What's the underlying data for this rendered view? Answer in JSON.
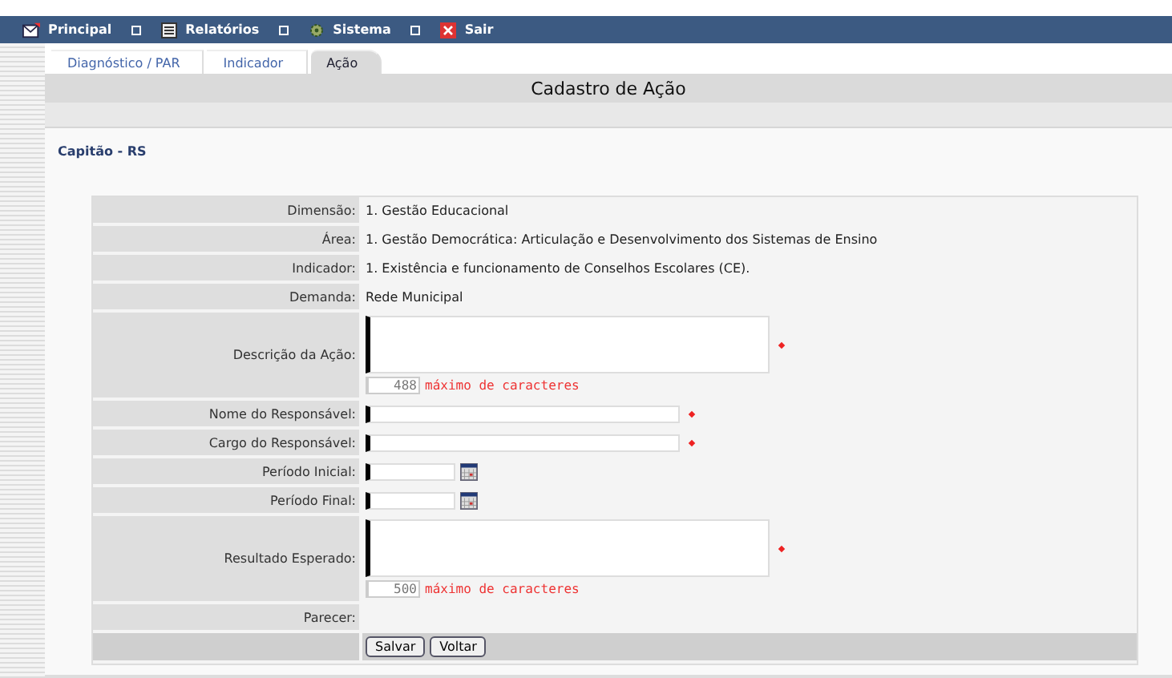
{
  "menu": [
    {
      "label": "Principal"
    },
    {
      "label": "Relatórios"
    },
    {
      "label": "Sistema"
    },
    {
      "label": "Sair"
    }
  ],
  "tabs": [
    {
      "label": "Diagnóstico / PAR",
      "selected": false
    },
    {
      "label": "Indicador",
      "selected": false
    },
    {
      "label": "Ação",
      "selected": true
    }
  ],
  "page_title": "Cadastro de Ação",
  "location": "Capitão - RS",
  "form": {
    "rows": [
      {
        "kind": "text",
        "label": "Dimensão:",
        "value": "1. Gestão Educacional"
      },
      {
        "kind": "text",
        "label": "Área:",
        "value": "1. Gestão Democrática: Articulação e Desenvolvimento dos Sistemas de Ensino"
      },
      {
        "kind": "text",
        "label": "Indicador:",
        "value": "1. Existência e funcionamento de Conselhos Escolares (CE)."
      },
      {
        "kind": "text",
        "label": "Demanda:",
        "value": "Rede Municipal"
      },
      {
        "kind": "textarea",
        "label": "Descrição da Ação:",
        "required": true,
        "counter": "488",
        "counter_note": "máximo de caracteres"
      },
      {
        "kind": "input",
        "label": "Nome do Responsável:",
        "required": true
      },
      {
        "kind": "input",
        "label": "Cargo do Responsável:",
        "required": true
      },
      {
        "kind": "date",
        "label": "Período Inicial:"
      },
      {
        "kind": "date",
        "label": "Período Final:"
      },
      {
        "kind": "textarea",
        "label": "Resultado Esperado:",
        "required": true,
        "counter": "500",
        "counter_note": "máximo de caracteres"
      },
      {
        "kind": "empty",
        "label": "Parecer:"
      }
    ],
    "buttons": [
      "Salvar",
      "Voltar"
    ]
  }
}
